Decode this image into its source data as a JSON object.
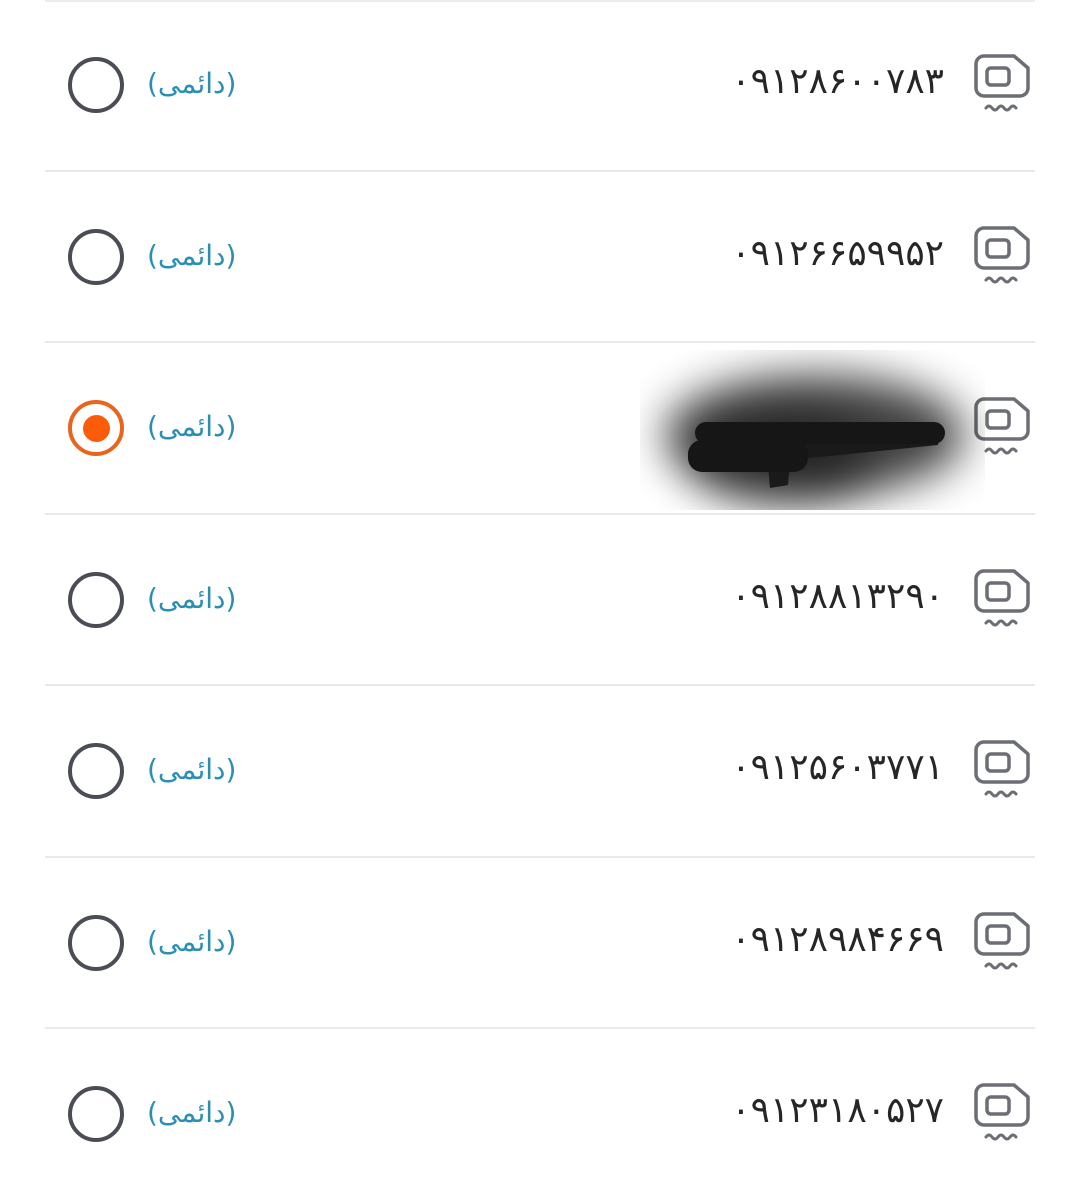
{
  "lines": [
    {
      "number": "۰۹۱۲۸۶۰۰۷۸۳",
      "type": "(دائمی)",
      "selected": false
    },
    {
      "number": "۰۹۱۲۶۶۵۹۹۵۲",
      "type": "(دائمی)",
      "selected": false
    },
    {
      "number": "",
      "type": "(دائمی)",
      "selected": true
    },
    {
      "number": "۰۹۱۲۸۸۱۳۲۹۰",
      "type": "(دائمی)",
      "selected": false
    },
    {
      "number": "۰۹۱۲۵۶۰۳۷۷۱",
      "type": "(دائمی)",
      "selected": false
    },
    {
      "number": "۰۹۱۲۸۹۸۴۶۶۹",
      "type": "(دائمی)",
      "selected": false
    },
    {
      "number": "۰۹۱۲۳۱۸۰۵۲۷",
      "type": "(دائمی)",
      "selected": false
    }
  ],
  "icons": {
    "sim": "sim-card-icon"
  },
  "colors": {
    "selected": "#fb5c08",
    "type_label": "#2a8fb3",
    "radio_border": "#4a4d55"
  }
}
